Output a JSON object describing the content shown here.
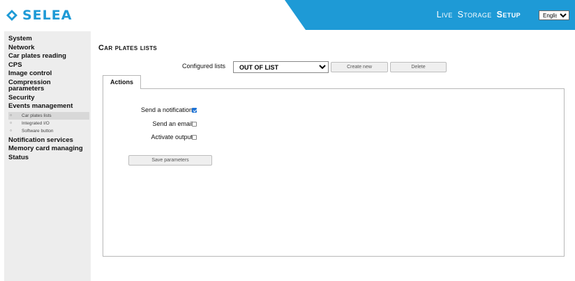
{
  "brand": {
    "name": "SELEA",
    "color": "#1e9ad6",
    "logo_icon": "selea-diamond-icon"
  },
  "topnav": {
    "items": [
      {
        "label": "Live",
        "active": false
      },
      {
        "label": "Storage",
        "active": false
      },
      {
        "label": "Setup",
        "active": true
      }
    ],
    "language": {
      "selected": "English",
      "options": [
        "English"
      ]
    }
  },
  "sidebar": {
    "system": "System",
    "network": "Network",
    "car_plates_reading": "Car plates reading",
    "cps": "CPS",
    "image_control": "Image control",
    "compression_parameters": "Compression parameters",
    "security": "Security",
    "events_management": "Events management",
    "events_sub": {
      "car_plates_lists": "Car plates lists",
      "integrated_io": "Integrated I/O",
      "software_button": "Software button"
    },
    "notification_services": "Notification services",
    "memory_card_managing": "Memory card managing",
    "status": "Status"
  },
  "main": {
    "title": "Car plates lists",
    "configured_lists": {
      "label": "Configured lists",
      "selected": "OUT OF LIST",
      "create_label": "Create new",
      "delete_label": "Delete"
    },
    "tab_label": "Actions",
    "options": {
      "send_notification": {
        "label": "Send a notification",
        "checked": true
      },
      "send_email": {
        "label": "Send an email",
        "checked": false
      },
      "activate_output": {
        "label": "Activate output",
        "checked": false
      }
    },
    "save_label": "Save parameters"
  }
}
